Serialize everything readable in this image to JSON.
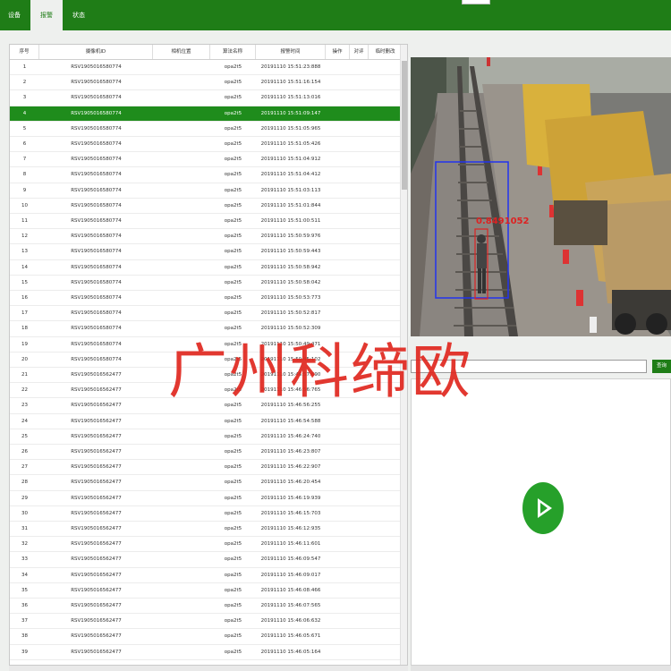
{
  "tabs": [
    "设备",
    "报警",
    "状态"
  ],
  "active_tab": 1,
  "table": {
    "columns": [
      "序号",
      "摄像机ID",
      "相机位置",
      "算法名称",
      "报警时间",
      "操作",
      "对评",
      "临时删改"
    ],
    "selected_row": 3,
    "rows": [
      {
        "no": "1",
        "camera_id": "RSV1905016580774",
        "location": "",
        "algorithm": "opa2t5",
        "time": "20191110 15:51:23:888"
      },
      {
        "no": "2",
        "camera_id": "RSV1905016580774",
        "location": "",
        "algorithm": "opa2t5",
        "time": "20191110 15:51:16:154"
      },
      {
        "no": "3",
        "camera_id": "RSV1905016580774",
        "location": "",
        "algorithm": "opa2t5",
        "time": "20191110 15:51:13:016"
      },
      {
        "no": "4",
        "camera_id": "RSV1905016580774",
        "location": "",
        "algorithm": "opa2t5",
        "time": "20191110 15:51:09:147"
      },
      {
        "no": "5",
        "camera_id": "RSV1905016580774",
        "location": "",
        "algorithm": "opa2t5",
        "time": "20191110 15:51:05:965"
      },
      {
        "no": "6",
        "camera_id": "RSV1905016580774",
        "location": "",
        "algorithm": "opa2t5",
        "time": "20191110 15:51:05:426"
      },
      {
        "no": "7",
        "camera_id": "RSV1905016580774",
        "location": "",
        "algorithm": "opa2t5",
        "time": "20191110 15:51:04:912"
      },
      {
        "no": "8",
        "camera_id": "RSV1905016580774",
        "location": "",
        "algorithm": "opa2t5",
        "time": "20191110 15:51:04:412"
      },
      {
        "no": "9",
        "camera_id": "RSV1905016580774",
        "location": "",
        "algorithm": "opa2t5",
        "time": "20191110 15:51:03:113"
      },
      {
        "no": "10",
        "camera_id": "RSV1905016580774",
        "location": "",
        "algorithm": "opa2t5",
        "time": "20191110 15:51:01:844"
      },
      {
        "no": "11",
        "camera_id": "RSV1905016580774",
        "location": "",
        "algorithm": "opa2t5",
        "time": "20191110 15:51:00:511"
      },
      {
        "no": "12",
        "camera_id": "RSV1905016580774",
        "location": "",
        "algorithm": "opa2t5",
        "time": "20191110 15:50:59:976"
      },
      {
        "no": "13",
        "camera_id": "RSV1905016580774",
        "location": "",
        "algorithm": "opa2t5",
        "time": "20191110 15:50:59:443"
      },
      {
        "no": "14",
        "camera_id": "RSV1905016580774",
        "location": "",
        "algorithm": "opa2t5",
        "time": "20191110 15:50:58:942"
      },
      {
        "no": "15",
        "camera_id": "RSV1905016580774",
        "location": "",
        "algorithm": "opa2t5",
        "time": "20191110 15:50:58:042"
      },
      {
        "no": "16",
        "camera_id": "RSV1905016580774",
        "location": "",
        "algorithm": "opa2t5",
        "time": "20191110 15:50:53:773"
      },
      {
        "no": "17",
        "camera_id": "RSV1905016580774",
        "location": "",
        "algorithm": "opa2t5",
        "time": "20191110 15:50:52:817"
      },
      {
        "no": "18",
        "camera_id": "RSV1905016580774",
        "location": "",
        "algorithm": "opa2t5",
        "time": "20191110 15:50:52:309"
      },
      {
        "no": "19",
        "camera_id": "RSV1905016580774",
        "location": "",
        "algorithm": "opa2t5",
        "time": "20191110 15:50:49:471"
      },
      {
        "no": "20",
        "camera_id": "RSV1905016580774",
        "location": "",
        "algorithm": "opa2t5",
        "time": "20191110 15:50:45:102"
      },
      {
        "no": "21",
        "camera_id": "RSV1905016562477",
        "location": "",
        "algorithm": "opa2t5",
        "time": "20191110 15:46:57:690"
      },
      {
        "no": "22",
        "camera_id": "RSV1905016562477",
        "location": "",
        "algorithm": "opa2t5",
        "time": "20191110 15:46:56:765"
      },
      {
        "no": "23",
        "camera_id": "RSV1905016562477",
        "location": "",
        "algorithm": "opa2t5",
        "time": "20191110 15:46:56:255"
      },
      {
        "no": "24",
        "camera_id": "RSV1905016562477",
        "location": "",
        "algorithm": "opa2t5",
        "time": "20191110 15:46:54:588"
      },
      {
        "no": "25",
        "camera_id": "RSV1905016562477",
        "location": "",
        "algorithm": "opa2t5",
        "time": "20191110 15:46:24:740"
      },
      {
        "no": "26",
        "camera_id": "RSV1905016562477",
        "location": "",
        "algorithm": "opa2t5",
        "time": "20191110 15:46:23:807"
      },
      {
        "no": "27",
        "camera_id": "RSV1905016562477",
        "location": "",
        "algorithm": "opa2t5",
        "time": "20191110 15:46:22:907"
      },
      {
        "no": "28",
        "camera_id": "RSV1905016562477",
        "location": "",
        "algorithm": "opa2t5",
        "time": "20191110 15:46:20:454"
      },
      {
        "no": "29",
        "camera_id": "RSV1905016562477",
        "location": "",
        "algorithm": "opa2t5",
        "time": "20191110 15:46:19:939"
      },
      {
        "no": "30",
        "camera_id": "RSV1905016562477",
        "location": "",
        "algorithm": "opa2t5",
        "time": "20191110 15:46:15:703"
      },
      {
        "no": "31",
        "camera_id": "RSV1905016562477",
        "location": "",
        "algorithm": "opa2t5",
        "time": "20191110 15:46:12:935"
      },
      {
        "no": "32",
        "camera_id": "RSV1905016562477",
        "location": "",
        "algorithm": "opa2t5",
        "time": "20191110 15:46:11:601"
      },
      {
        "no": "33",
        "camera_id": "RSV1905016562477",
        "location": "",
        "algorithm": "opa2t5",
        "time": "20191110 15:46:09:547"
      },
      {
        "no": "34",
        "camera_id": "RSV1905016562477",
        "location": "",
        "algorithm": "opa2t5",
        "time": "20191110 15:46:09:017"
      },
      {
        "no": "35",
        "camera_id": "RSV1905016562477",
        "location": "",
        "algorithm": "opa2t5",
        "time": "20191110 15:46:08:466"
      },
      {
        "no": "36",
        "camera_id": "RSV1905016562477",
        "location": "",
        "algorithm": "opa2t5",
        "time": "20191110 15:46:07:565"
      },
      {
        "no": "37",
        "camera_id": "RSV1905016562477",
        "location": "",
        "algorithm": "opa2t5",
        "time": "20191110 15:46:06:632"
      },
      {
        "no": "38",
        "camera_id": "RSV1905016562477",
        "location": "",
        "algorithm": "opa2t5",
        "time": "20191110 15:46:05:671"
      },
      {
        "no": "39",
        "camera_id": "RSV1905016562477",
        "location": "",
        "algorithm": "opa2t5",
        "time": "20191110 15:46:05:164"
      }
    ]
  },
  "video": {
    "detection_label": "0.8491052",
    "box_color": "#2233ee",
    "person_box_color": "#dd2222"
  },
  "search": {
    "value": "",
    "button_label": "查询"
  },
  "player": {
    "icon": "play-icon",
    "accent": "#26a02a"
  },
  "watermark": "广州科缔欧",
  "colors": {
    "brand": "#1f7d17",
    "selected_row": "#1f8c1c"
  }
}
